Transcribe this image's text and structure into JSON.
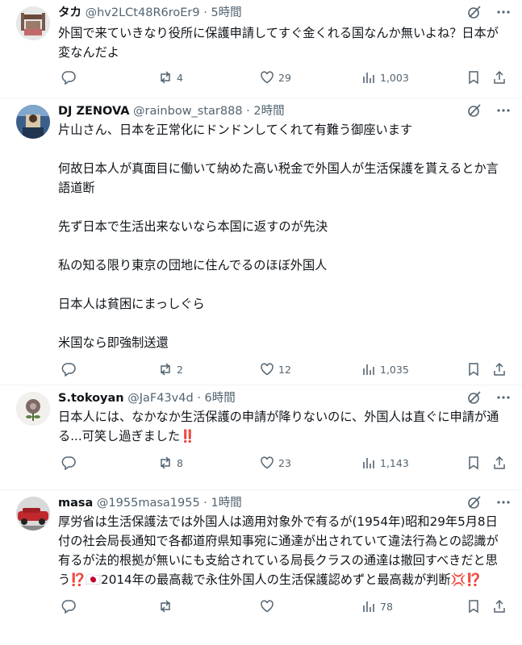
{
  "posts": [
    {
      "name": "タカ",
      "handle": "@hv2LCt48R6roEr9",
      "dot": "·",
      "time": "5時間",
      "text": "外国で来ていきなり役所に保護申請してすぐ金くれる国なんか無いよね？日本が変なんだよ",
      "replies": "",
      "reposts": "4",
      "likes": "29",
      "views": "1,003"
    },
    {
      "name": "DJ ZENOVA",
      "handle": "@rainbow_star888",
      "dot": "·",
      "time": "2時間",
      "text": "片山さん、日本を正常化にドンドンしてくれて有難う御座います\n\n何故日本人が真面目に働いて納めた高い税金で外国人が生活保護を貰えるとか言語道断\n\n先ず日本で生活出来ないなら本国に返すのが先決\n\n私の知る限り東京の団地に住んでるのほぼ外国人\n\n日本人は貧困にまっしぐら\n\n米国なら即強制送還",
      "replies": "",
      "reposts": "2",
      "likes": "12",
      "views": "1,035"
    },
    {
      "name": "S.tokoyan",
      "handle": "@JaF43v4d",
      "dot": "·",
      "time": "6時間",
      "text": "日本人には、なかなか生活保護の申請が降りないのに、外国人は直ぐに申請が通る...可笑し過ぎました",
      "text_emoji": "‼️",
      "replies": "",
      "reposts": "8",
      "likes": "23",
      "views": "1,143"
    },
    {
      "name": "masa",
      "handle": "@1955masa1955",
      "dot": "·",
      "time": "1時間",
      "text_a": "厚労省は生活保護法では外国人は適用対象外で有るが(1954年)昭和29年5月8日付の社会局長通知で各都道府県知事宛に通達が出されていて違法行為との認識が有るが法的根拠が無いにも支給されている局長クラスの通達は撤回すべきだと思う",
      "emoji_1": "⁉️",
      "emoji_2": "🇯🇵",
      "text_b": "2014年の最高裁で永住外国人の生活保護認めずと最高裁が判断",
      "emoji_3": "💢⁉️",
      "replies": "",
      "reposts": "",
      "likes": "",
      "views": "78"
    }
  ],
  "icons": {
    "grok": "grok-icon",
    "more": "more-icon",
    "reply": "reply-icon",
    "repost": "repost-icon",
    "like": "like-icon",
    "views": "views-icon",
    "bookmark": "bookmark-icon",
    "share": "share-icon"
  },
  "colors": {
    "text": "#0f1419",
    "secondary": "#536471",
    "border": "#eff3f4"
  }
}
